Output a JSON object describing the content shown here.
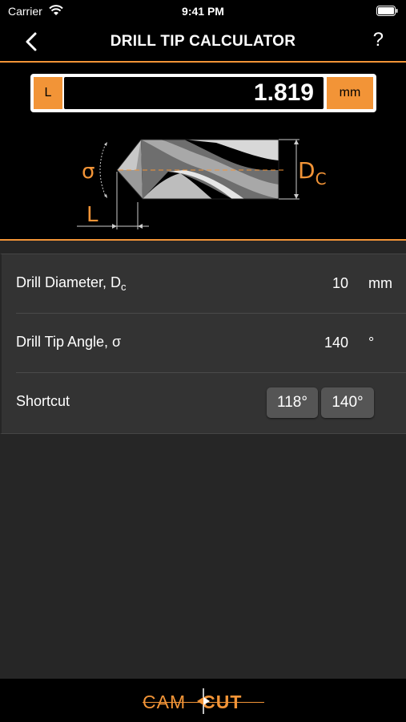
{
  "status_bar": {
    "carrier": "Carrier",
    "time": "9:41 PM"
  },
  "nav": {
    "title": "DRILL TIP CALCULATOR",
    "help_label": "?"
  },
  "result": {
    "symbol": "L",
    "value": "1.819",
    "unit": "mm"
  },
  "diagram": {
    "sigma_label": "σ",
    "dc_label": "D",
    "dc_sub": "C",
    "l_label": "L"
  },
  "rows": [
    {
      "label": "Drill Diameter, D",
      "label_sub": "c",
      "value": "10",
      "unit": "mm"
    },
    {
      "label": "Drill Tip Angle, σ",
      "value": "140",
      "unit": "°"
    },
    {
      "label": "Shortcut",
      "options": [
        "118°",
        "140°"
      ]
    }
  ],
  "footer": {
    "brand_left": "CAM",
    "brand_right": "CUT"
  },
  "colors": {
    "accent": "#f29437",
    "background": "#262626",
    "panel": "#000000",
    "list_bg": "#333333"
  }
}
